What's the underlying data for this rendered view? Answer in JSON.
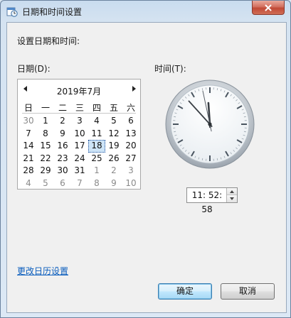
{
  "window": {
    "title": "日期和时间设置",
    "close_glyph": "✕"
  },
  "labels": {
    "heading": "设置日期和时间:",
    "date": "日期(D):",
    "time": "时间(T):"
  },
  "calendar": {
    "prev_glyph": "◀",
    "next_glyph": "▶",
    "month_title": "2019年7月",
    "weekdays": [
      "日",
      "一",
      "二",
      "三",
      "四",
      "五",
      "六"
    ],
    "weeks": [
      [
        "30",
        "1",
        "2",
        "3",
        "4",
        "5",
        "6"
      ],
      [
        "7",
        "8",
        "9",
        "10",
        "11",
        "12",
        "13"
      ],
      [
        "14",
        "15",
        "16",
        "17",
        "18",
        "19",
        "20"
      ],
      [
        "21",
        "22",
        "23",
        "24",
        "25",
        "26",
        "27"
      ],
      [
        "28",
        "29",
        "30",
        "31",
        "1",
        "2",
        "3"
      ],
      [
        "4",
        "5",
        "6",
        "7",
        "8",
        "9",
        "10"
      ]
    ],
    "outside_month": [
      [
        0,
        0
      ],
      [
        4,
        4
      ],
      [
        4,
        5
      ],
      [
        4,
        6
      ],
      [
        5,
        0
      ],
      [
        5,
        1
      ],
      [
        5,
        2
      ],
      [
        5,
        3
      ],
      [
        5,
        4
      ],
      [
        5,
        5
      ],
      [
        5,
        6
      ]
    ],
    "selected": [
      2,
      4
    ]
  },
  "clock": {
    "hour": 11,
    "minute": 52,
    "second": 58,
    "face_color": "#ffffff",
    "hand_color": "#3a3f45",
    "second_hand_color": "#5a6068"
  },
  "time_field": {
    "value": "11: 52: 58"
  },
  "link": {
    "label": "更改日历设置"
  },
  "buttons": {
    "ok": "确定",
    "cancel": "取消"
  },
  "colors": {
    "link": "#0a5dbd",
    "default_button_border": "#3c7fb1",
    "close_button": "#c14a36"
  }
}
